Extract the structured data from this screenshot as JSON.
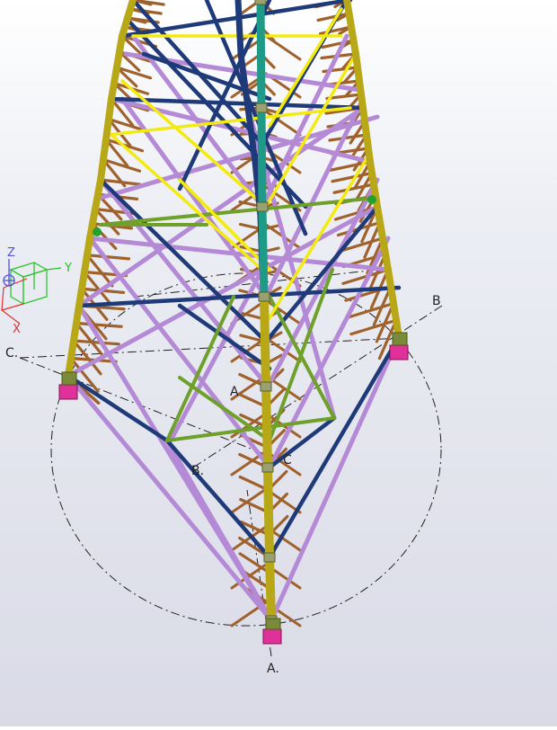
{
  "viewport": {
    "grid_labels": {
      "a_bottom": "A.",
      "a_center": "A",
      "b_right": "B",
      "b_center": "B.",
      "c_left": "C.",
      "c_center": "C"
    },
    "axes_gizmo": {
      "x": "X",
      "y": "Y",
      "z": "Z"
    },
    "colors": {
      "leg_yellow": "#b8a818",
      "leg_teal": "#1e9a86",
      "navy": "#1f3a78",
      "violet": "#b48ad6",
      "brown": "#a0622c",
      "bright_yellow": "#f2ea10",
      "green": "#6ea02a",
      "support_magenta": "#e0309a",
      "gizmo_green": "#22c322",
      "gizmo_red": "#e23030",
      "gizmo_blue": "#5050e0"
    }
  }
}
